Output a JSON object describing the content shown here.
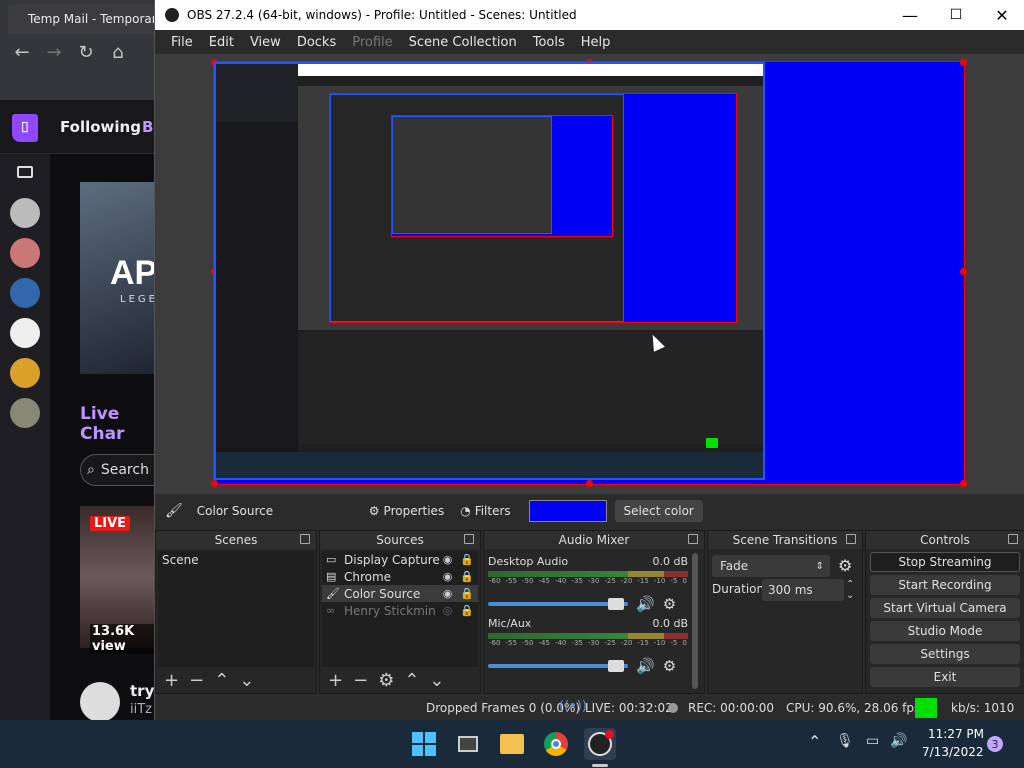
{
  "chrome": {
    "tab_title": "Temp Mail - Temporary",
    "back_icon": "←",
    "forward_icon": "→",
    "reload_icon": "↻",
    "home_icon": "⌂"
  },
  "twitch": {
    "following_label": "Following",
    "browse_partial": "Br",
    "game_title_partial": "AP",
    "game_subtitle_partial": "LEGE",
    "live_channels_label": "Live Char",
    "search_placeholder": "Search",
    "live_badge": "LIVE",
    "viewers": "13.6K view",
    "channel_name_partial": "tryh",
    "channel_sub_partial": "iiTz",
    "colors": {
      "brand": "#9146ff",
      "live": "#e91916"
    }
  },
  "obs": {
    "window_title": "OBS 27.2.4 (64-bit, windows) - Profile: Untitled - Scenes: Untitled",
    "menu": [
      "File",
      "Edit",
      "View",
      "Docks",
      "Profile",
      "Scene Collection",
      "Tools",
      "Help"
    ],
    "context_bar": {
      "source_name": "Color Source",
      "properties": "Properties",
      "filters": "Filters",
      "color_value": "#0000ff",
      "select_color": "Select color"
    },
    "scenes": {
      "title": "Scenes",
      "items": [
        "Scene"
      ]
    },
    "sources": {
      "title": "Sources",
      "items": [
        {
          "name": "Display Capture",
          "icon": "monitor-icon"
        },
        {
          "name": "Chrome",
          "icon": "window-icon"
        },
        {
          "name": "Color Source",
          "icon": "brush-icon"
        },
        {
          "name": "Henry Stickmin",
          "icon": "link-icon"
        }
      ]
    },
    "audio_mixer": {
      "title": "Audio Mixer",
      "ticks": [
        "-60",
        "-55",
        "-50",
        "-45",
        "-40",
        "-35",
        "-30",
        "-25",
        "-20",
        "-15",
        "-10",
        "-5",
        "0"
      ],
      "channels": [
        {
          "name": "Desktop Audio",
          "level": "0.0 dB"
        },
        {
          "name": "Mic/Aux",
          "level": "0.0 dB"
        }
      ]
    },
    "scene_transitions": {
      "title": "Scene Transitions",
      "transition": "Fade",
      "duration_label": "Duration",
      "duration_value": "300 ms"
    },
    "controls": {
      "title": "Controls",
      "buttons": [
        "Stop Streaming",
        "Start Recording",
        "Start Virtual Camera",
        "Studio Mode",
        "Settings",
        "Exit"
      ]
    },
    "status": {
      "dropped_frames": "Dropped Frames 0 (0.0%)",
      "live": "LIVE: 00:32:02",
      "rec": "REC: 00:00:00",
      "cpu": "CPU: 90.6%, 28.06 fps",
      "kbps": "kb/s: 1010"
    }
  },
  "taskbar": {
    "time": "11:27 PM",
    "date": "7/13/2022",
    "notifications": "3"
  }
}
